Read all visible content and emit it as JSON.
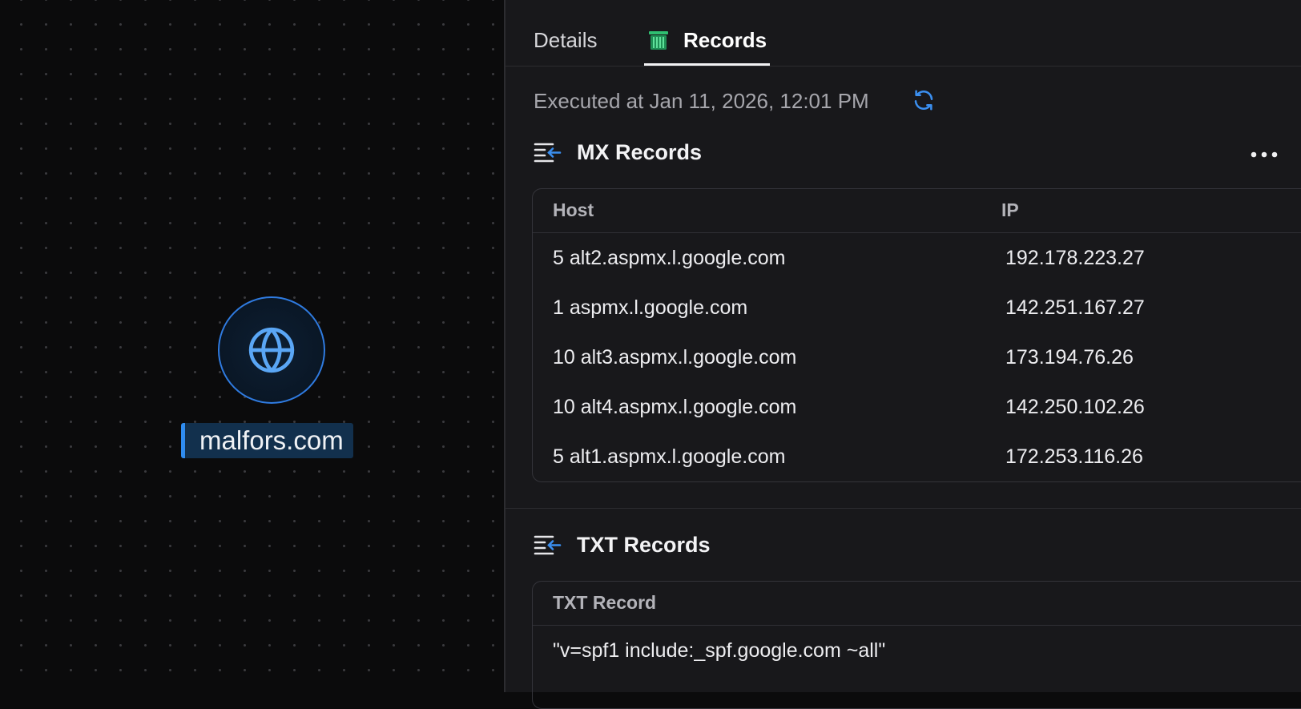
{
  "canvas": {
    "node_label": "malfors.com",
    "node_icon": "globe-icon"
  },
  "tabs": [
    {
      "label": "Details",
      "active": false
    },
    {
      "label": "Records",
      "active": true,
      "icon": "records-table-icon"
    }
  ],
  "executed_text": "Executed at Jan 11, 2026, 12:01 PM",
  "mx": {
    "title": "MX Records",
    "columns": [
      "Host",
      "IP"
    ],
    "rows": [
      {
        "host": "5 alt2.aspmx.l.google.com",
        "ip": "192.178.223.27"
      },
      {
        "host": "1 aspmx.l.google.com",
        "ip": "142.251.167.27"
      },
      {
        "host": "10 alt3.aspmx.l.google.com",
        "ip": "173.194.76.26"
      },
      {
        "host": "10 alt4.aspmx.l.google.com",
        "ip": "142.250.102.26"
      },
      {
        "host": "5 alt1.aspmx.l.google.com",
        "ip": "172.253.116.26"
      }
    ]
  },
  "txt": {
    "title": "TXT Records",
    "columns": [
      "TXT Record"
    ],
    "rows": [
      {
        "value": "\"v=spf1 include:_spf.google.com ~all\""
      }
    ]
  },
  "colors": {
    "accent": "#2f8cf0",
    "panel_bg": "#18181b",
    "canvas_bg": "#0b0b0c",
    "records_icon": "#2fbf71"
  }
}
